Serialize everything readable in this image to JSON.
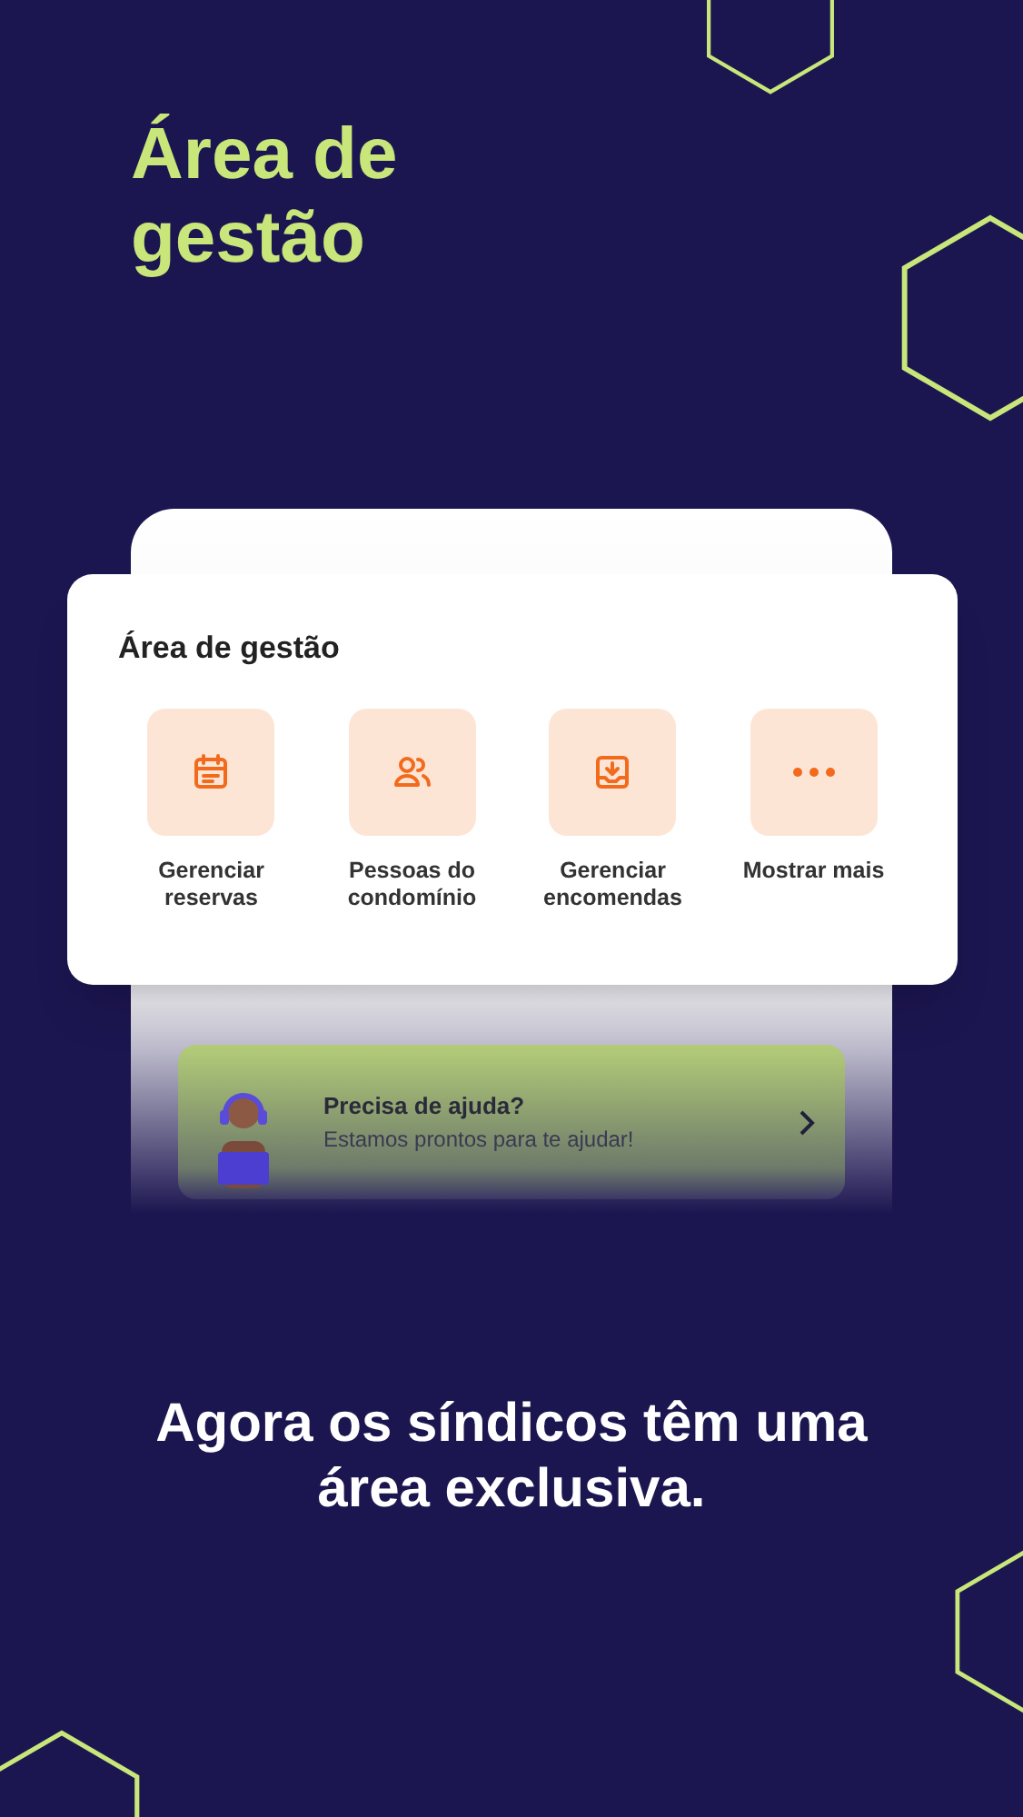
{
  "headline": "Área de gestão",
  "panel": {
    "title": "Área de gestão",
    "actions": [
      {
        "kind": "calendar",
        "label": "Gerenciar reservas"
      },
      {
        "kind": "people",
        "label": "Pessoas do condomínio"
      },
      {
        "kind": "inbox",
        "label": "Gerenciar encomendas"
      },
      {
        "kind": "more",
        "label": "Mostrar mais"
      }
    ]
  },
  "help_banner": {
    "title": "Precisa de ajuda?",
    "subtitle": "Estamos prontos para te ajudar!"
  },
  "caption": "Agora os síndicos têm uma área exclusiva."
}
